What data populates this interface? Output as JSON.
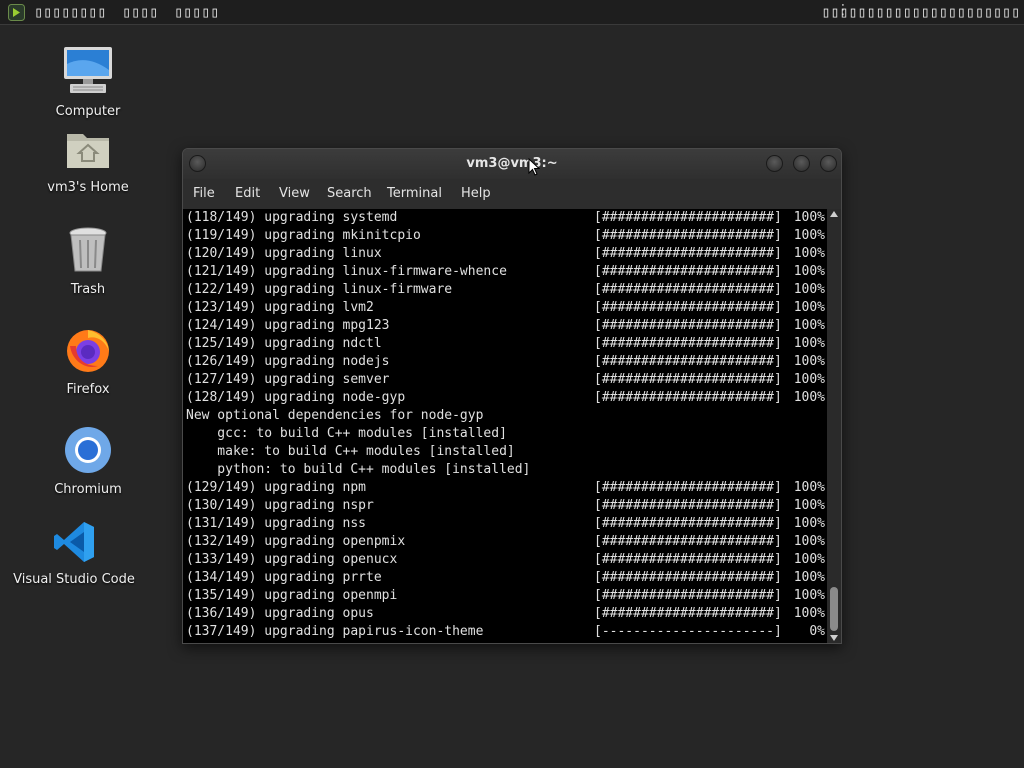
{
  "panel": {
    "menu_items": [
      "▯▯▯▯▯▯▯▯",
      "▯▯▯▯",
      "▯▯▯▯▯"
    ],
    "clock": "▯▯▯▯▯▯▯▯▯▯▯▯▯▯▯▯▯▯▯▯▯▯"
  },
  "desktop": {
    "icons": [
      {
        "label": "Computer",
        "icon": "computer-icon"
      },
      {
        "label": "vm3's Home",
        "icon": "home-folder-icon"
      },
      {
        "label": "Trash",
        "icon": "trash-icon"
      },
      {
        "label": "Firefox",
        "icon": "firefox-icon"
      },
      {
        "label": "Chromium",
        "icon": "chromium-icon"
      },
      {
        "label": "Visual Studio Code",
        "icon": "vscode-icon"
      }
    ]
  },
  "terminal": {
    "title": "vm3@vm3:~",
    "menu": [
      "File",
      "Edit",
      "View",
      "Search",
      "Terminal",
      "Help"
    ],
    "lines": [
      {
        "text": "(118/149) upgrading systemd",
        "bar": "[######################]",
        "pct": "100%"
      },
      {
        "text": "(119/149) upgrading mkinitcpio",
        "bar": "[######################]",
        "pct": "100%"
      },
      {
        "text": "(120/149) upgrading linux",
        "bar": "[######################]",
        "pct": "100%"
      },
      {
        "text": "(121/149) upgrading linux-firmware-whence",
        "bar": "[######################]",
        "pct": "100%"
      },
      {
        "text": "(122/149) upgrading linux-firmware",
        "bar": "[######################]",
        "pct": "100%"
      },
      {
        "text": "(123/149) upgrading lvm2",
        "bar": "[######################]",
        "pct": "100%"
      },
      {
        "text": "(124/149) upgrading mpg123",
        "bar": "[######################]",
        "pct": "100%"
      },
      {
        "text": "(125/149) upgrading ndctl",
        "bar": "[######################]",
        "pct": "100%"
      },
      {
        "text": "(126/149) upgrading nodejs",
        "bar": "[######################]",
        "pct": "100%"
      },
      {
        "text": "(127/149) upgrading semver",
        "bar": "[######################]",
        "pct": "100%"
      },
      {
        "text": "(128/149) upgrading node-gyp",
        "bar": "[######################]",
        "pct": "100%"
      },
      {
        "text": "New optional dependencies for node-gyp",
        "bar": "",
        "pct": ""
      },
      {
        "text": "    gcc: to build C++ modules [installed]",
        "bar": "",
        "pct": ""
      },
      {
        "text": "    make: to build C++ modules [installed]",
        "bar": "",
        "pct": ""
      },
      {
        "text": "    python: to build C++ modules [installed]",
        "bar": "",
        "pct": ""
      },
      {
        "text": "(129/149) upgrading npm",
        "bar": "[######################]",
        "pct": "100%"
      },
      {
        "text": "(130/149) upgrading nspr",
        "bar": "[######################]",
        "pct": "100%"
      },
      {
        "text": "(131/149) upgrading nss",
        "bar": "[######################]",
        "pct": "100%"
      },
      {
        "text": "(132/149) upgrading openpmix",
        "bar": "[######################]",
        "pct": "100%"
      },
      {
        "text": "(133/149) upgrading openucx",
        "bar": "[######################]",
        "pct": "100%"
      },
      {
        "text": "(134/149) upgrading prrte",
        "bar": "[######################]",
        "pct": "100%"
      },
      {
        "text": "(135/149) upgrading openmpi",
        "bar": "[######################]",
        "pct": "100%"
      },
      {
        "text": "(136/149) upgrading opus",
        "bar": "[######################]",
        "pct": "100%"
      },
      {
        "text": "(137/149) upgrading papirus-icon-theme",
        "bar": "[----------------------]",
        "pct": "0%"
      }
    ]
  }
}
